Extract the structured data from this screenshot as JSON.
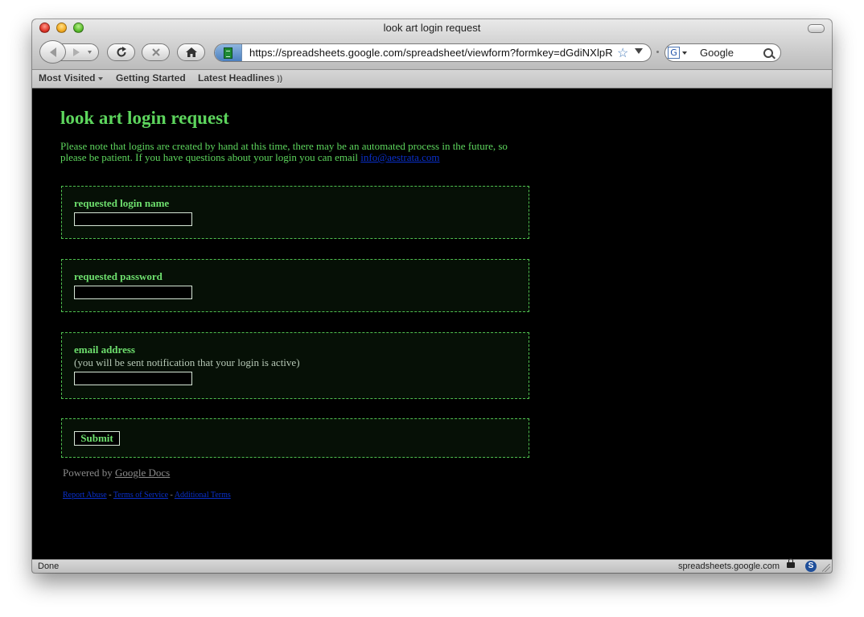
{
  "window": {
    "title": "look art login request"
  },
  "toolbar": {
    "url": "https://spreadsheets.google.com/spreadsheet/viewform?formkey=dGdiNXlpR",
    "search_engine_icon": "G",
    "search_placeholder": "Google"
  },
  "bookmarks": [
    {
      "label": "Most Visited",
      "has_menu": true
    },
    {
      "label": "Getting Started"
    },
    {
      "label": "Latest Headlines",
      "has_feed": true
    }
  ],
  "page": {
    "title": "look art login request",
    "description": "Please note that logins are created by hand at this time, there may be an automated process in the future, so please be patient.  If you have questions about your login you can email",
    "email_link": "info@aestrata.com",
    "questions": [
      {
        "label": "requested login name"
      },
      {
        "label": "requested password"
      },
      {
        "label": "email address",
        "help": "(you will be sent notification that your login is active)"
      }
    ],
    "submit_label": "Submit",
    "powered_by": "Powered by",
    "powered_link": "Google Docs",
    "footer_links": [
      "Report Abuse",
      "Terms of Service",
      "Additional Terms"
    ],
    "footer_separator": " - "
  },
  "status": {
    "left": "Done",
    "host": "spreadsheets.google.com",
    "addon_icon": "S"
  },
  "colors": {
    "page_bg": "#000000",
    "accent_green": "#5dd55d",
    "link_blue": "#0a30cc"
  }
}
